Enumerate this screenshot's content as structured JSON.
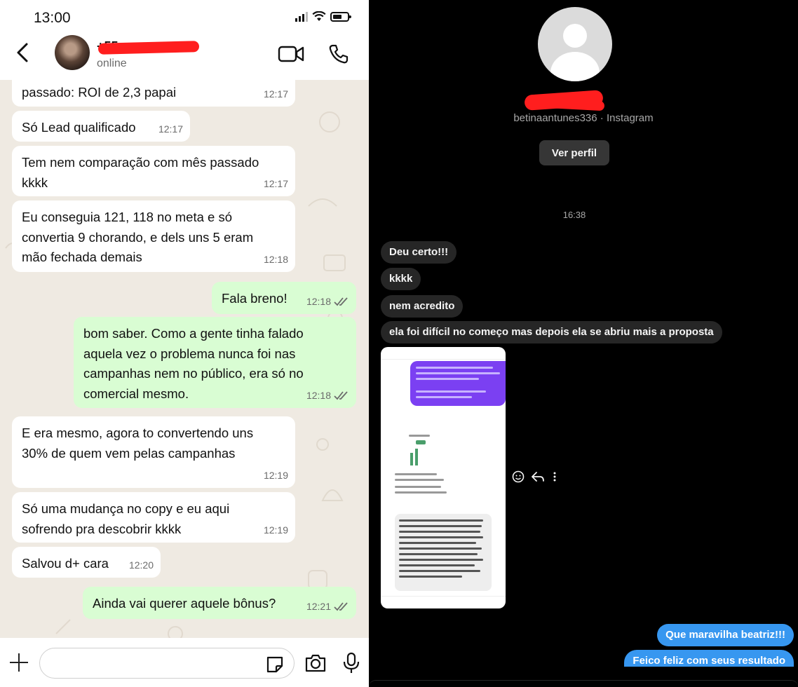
{
  "whatsapp": {
    "status_bar": {
      "time": "13:00"
    },
    "header": {
      "contact_name": "+55 ",
      "contact_status": "online"
    },
    "messages": [
      {
        "dir": "in",
        "text": "passado: ROI de 2,3 papai",
        "time": "12:17"
      },
      {
        "dir": "in",
        "text": "Só Lead qualificado",
        "time": "12:17"
      },
      {
        "dir": "in",
        "text": "Tem nem comparação com mês passado kkkk",
        "time": "12:17"
      },
      {
        "dir": "in",
        "text": "Eu conseguia 121, 118 no meta e só convertia 9 chorando, e dels uns 5 eram mão fechada demais",
        "time": "12:18"
      },
      {
        "dir": "out",
        "text": "Fala breno!",
        "time": "12:18",
        "read": true
      },
      {
        "dir": "out",
        "text": "bom saber. Como a gente tinha falado aquela vez o problema nunca foi nas campanhas nem no público, era só no comercial mesmo.",
        "time": "12:18",
        "read": true
      },
      {
        "dir": "in",
        "text": "E era mesmo, agora to convertendo uns 30% de quem vem pelas campanhas",
        "time": "12:19"
      },
      {
        "dir": "in",
        "text": "Só uma mudança no copy e eu aqui sofrendo pra descobrir kkkk",
        "time": "12:19"
      },
      {
        "dir": "in",
        "text": "Salvou d+ cara",
        "time": "12:20"
      },
      {
        "dir": "out",
        "text": "Ainda vai querer aquele bônus?",
        "time": "12:21",
        "read": true
      }
    ],
    "input": {
      "placeholder": ""
    },
    "colors": {
      "chat_bg": "#efeae2",
      "incoming": "#ffffff",
      "outgoing": "#d9fdd3",
      "redaction": "#ff1e1e"
    }
  },
  "instagram": {
    "username_line": "betinaantunes336 · Instagram",
    "view_profile_label": "Ver perfil",
    "time_divider": "16:38",
    "messages": [
      {
        "dir": "in",
        "text": "Deu certo!!!"
      },
      {
        "dir": "in",
        "text": "kkkk"
      },
      {
        "dir": "in",
        "text": "nem acredito"
      },
      {
        "dir": "in",
        "text": "ela foi difícil no começo mas depois ela se abriu mais a proposta"
      },
      {
        "dir": "out",
        "text": "Que maravilha beatriz!!!"
      },
      {
        "dir": "out",
        "text": "Feico feliz com seus resultado"
      }
    ],
    "colors": {
      "bg": "#000000",
      "incoming": "#262626",
      "outgoing": "#3797f0",
      "muted": "#a8a8a8"
    }
  }
}
